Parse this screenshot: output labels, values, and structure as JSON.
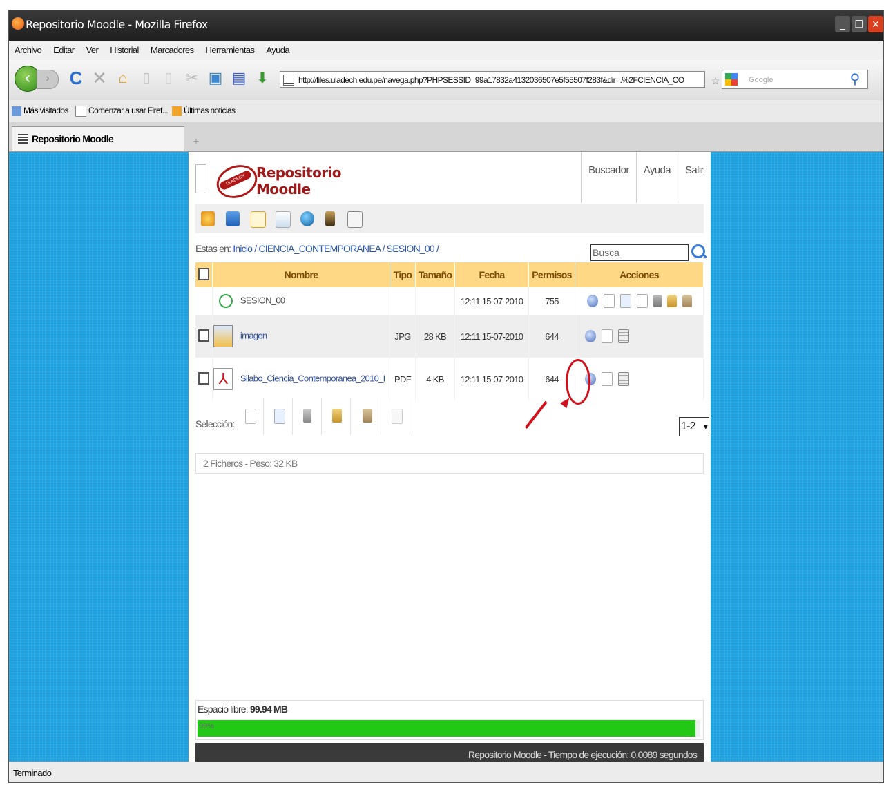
{
  "window": {
    "title": "Repositorio Moodle - Mozilla Firefox"
  },
  "menu": [
    "Archivo",
    "Editar",
    "Ver",
    "Historial",
    "Marcadores",
    "Herramientas",
    "Ayuda"
  ],
  "address_bar": {
    "url": "http://files.uladech.edu.pe/navega.php?PHPSESSID=99a17832a4132036507e5f55507f283f&dir=.%2FCIENCIA_CO"
  },
  "search_bar": {
    "placeholder": "Google"
  },
  "bookmarks": [
    "Más visitados",
    "Comenzar a usar Firef...",
    "Últimas noticias"
  ],
  "tab": {
    "title": "Repositorio Moodle",
    "new_tab": "+"
  },
  "site": {
    "brand_line1": "Repositorio",
    "brand_line2": "Moodle",
    "top_links": [
      "Buscador",
      "Ayuda",
      "Salir"
    ],
    "breadcrumb_prefix": "Estas en:",
    "breadcrumb_path": "Inicio / CIENCIA_CONTEMPORANEA / SESION_00 /",
    "search_value": "Busca",
    "table": {
      "headers": [
        "Nombre",
        "Tipo",
        "Tamaño",
        "Fecha",
        "Permisos",
        "Acciones"
      ],
      "rows": [
        {
          "name": "SESION_00",
          "type": "",
          "size": "",
          "date": "12:11 15-07-2010",
          "perms": "755"
        },
        {
          "name": "imagen",
          "type": "JPG",
          "size": "28 KB",
          "date": "12:11 15-07-2010",
          "perms": "644"
        },
        {
          "name": "Silabo_Ciencia_Contemporanea_2010_I",
          "type": "PDF",
          "size": "4 KB",
          "date": "12:11 15-07-2010",
          "perms": "644"
        }
      ]
    },
    "selection_label": "Selección:",
    "pager_value": "1-2",
    "summary": "2 Ficheros - Peso: 32 KB",
    "quota_label": "Espacio libre:",
    "quota_value": "99.94 MB",
    "quota_percent_label": "99%",
    "quota_fraction": 0.99,
    "footer": "Repositorio Moodle - Tiempo de ejecución: 0,0089 segundos"
  },
  "status": "Terminado",
  "colors": {
    "page_bg": "#1da1e0",
    "header_row": "#ffd885",
    "brand": "#9c1a1a",
    "quota_fill": "#22c815",
    "annotation": "#d0101a"
  }
}
